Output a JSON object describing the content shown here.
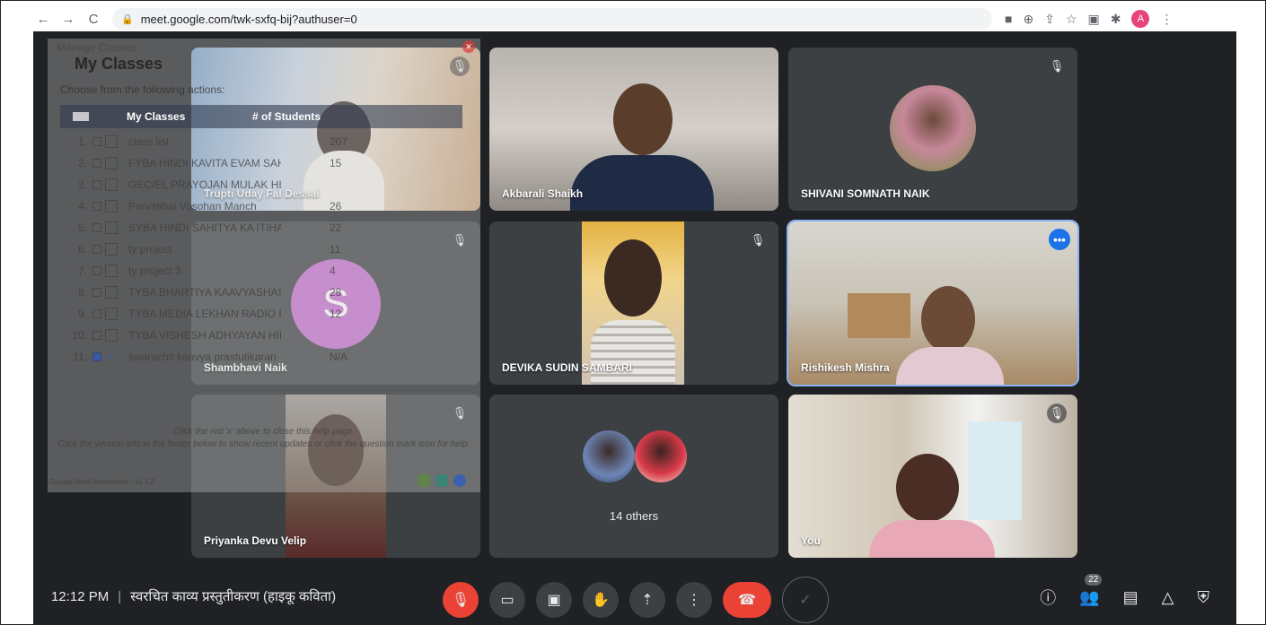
{
  "browser": {
    "back": "←",
    "forward": "→",
    "reload": "C",
    "url": "meet.google.com/twk-sxfq-bij?authuser=0",
    "profile_initial": "A"
  },
  "overlay": {
    "window_title": "Manage Classes",
    "title": "My Classes",
    "subtitle": "Choose from the following actions:",
    "col_classes": "My Classes",
    "col_students": "# of Students",
    "rows": [
      {
        "num": "1.",
        "name": "class list",
        "count": "207"
      },
      {
        "num": "2.",
        "name": "FYBA HINDI KAVITA EVAM SAHITYA",
        "count": "15"
      },
      {
        "num": "3.",
        "name": "GEC/EL PRAYOJAN MULAK HINDI AUR EVAM PATR",
        "count": ""
      },
      {
        "num": "4.",
        "name": "Parvatibai Vosohan Manch",
        "count": "26"
      },
      {
        "num": "5.",
        "name": "SYBA HINDI SAHITYA KA ITIHAS -AADIKAAL ,BHAKTIKAAL",
        "count": "22"
      },
      {
        "num": "6.",
        "name": "ty project",
        "count": "11"
      },
      {
        "num": "7.",
        "name": "ty project 3",
        "count": "4"
      },
      {
        "num": "8.",
        "name": "TYBA BHARTIYA KAAVYASHASTRA",
        "count": "28"
      },
      {
        "num": "9.",
        "name": "TYBA MEDIA LEKHAN RADIO EVAM TELEVISION",
        "count": "12"
      },
      {
        "num": "10.",
        "name": "TYBA VISHESH ADHYAYAN HINDI UPANYAAS",
        "count": ""
      },
      {
        "num": "11.",
        "name": "swarachit kaavya prastutikaran",
        "count": "N/A"
      }
    ],
    "help_line1": "Click the red 'x' above to close this help page.",
    "help_line2": "Click the version info in the footer below to show recent updates or click the question mark icon for help.",
    "version": "Google Meet Attendance - v1.5.2"
  },
  "tiles": [
    {
      "name": "Trupti Uday Fal Dessai"
    },
    {
      "name": "Akbarali Shaikh"
    },
    {
      "name": "SHIVANI SOMNATH NAIK"
    },
    {
      "name": "Shambhavi Naik",
      "initial": "S"
    },
    {
      "name": "DEVIKA SUDIN SAMBARI"
    },
    {
      "name": "Rishikesh Mishra"
    },
    {
      "name": "Priyanka Devu Velip"
    },
    {
      "name": "14 others"
    },
    {
      "name": "You"
    }
  ],
  "bottom": {
    "time": "12:12 PM",
    "separator": "|",
    "meeting_title": "स्वरचित काव्य प्रस्तुतीकरण (हाइकू कविता)",
    "participant_count": "22"
  },
  "icons": {
    "mic_off": "🎙",
    "more": "•••",
    "hand": "✋"
  }
}
